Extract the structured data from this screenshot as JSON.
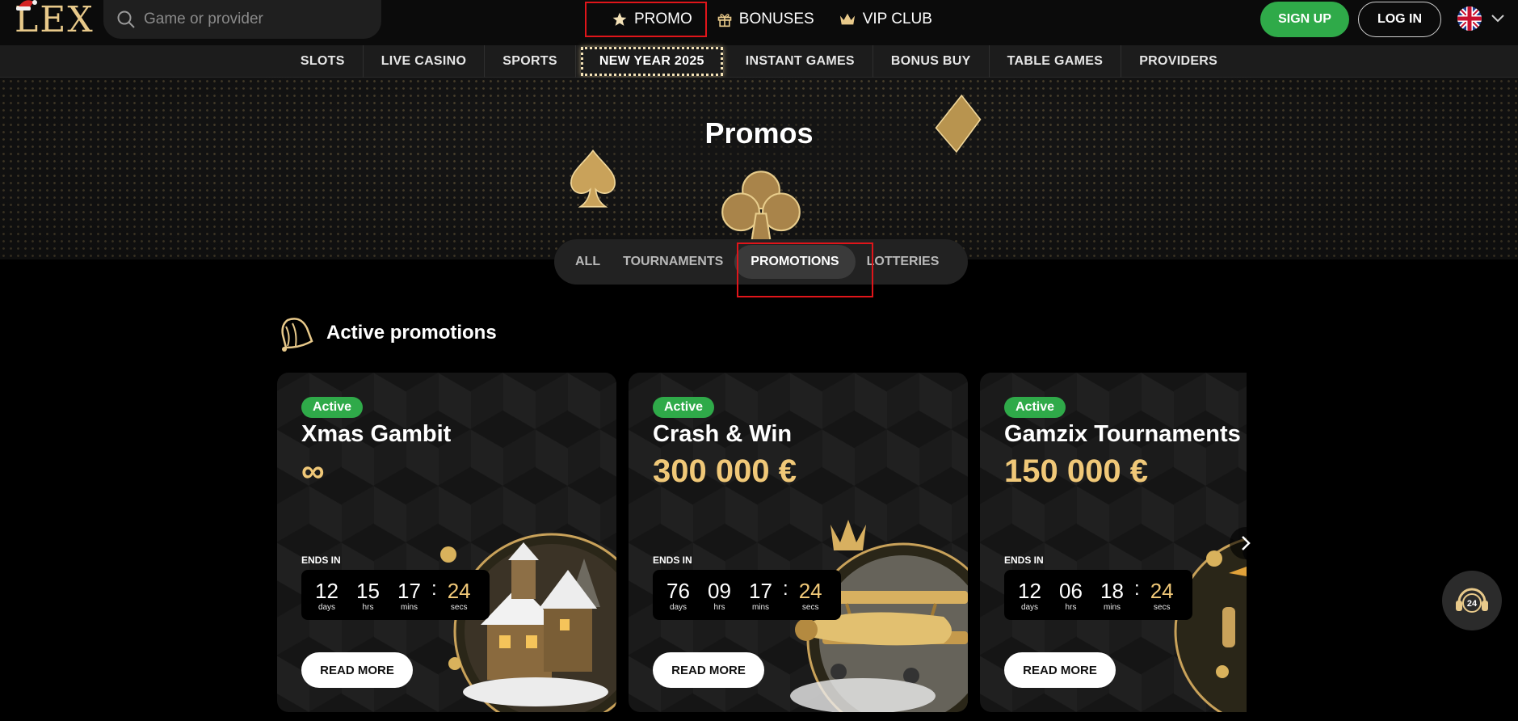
{
  "header": {
    "logo_text": "LEX",
    "search_placeholder": "Game or provider",
    "nav": [
      {
        "label": "PROMO",
        "icon": "star-icon"
      },
      {
        "label": "BONUSES",
        "icon": "gift-icon"
      },
      {
        "label": "VIP CLUB",
        "icon": "crown-icon"
      }
    ],
    "signup_label": "SIGN UP",
    "login_label": "LOG IN",
    "language_icon": "uk-flag-icon"
  },
  "categories": [
    "SLOTS",
    "LIVE CASINO",
    "SPORTS",
    "NEW YEAR 2025",
    "INSTANT GAMES",
    "BONUS BUY",
    "TABLE GAMES",
    "PROVIDERS"
  ],
  "hero": {
    "title": "Promos"
  },
  "tabs": [
    {
      "label": "ALL",
      "active": false
    },
    {
      "label": "TOURNAMENTS",
      "active": false
    },
    {
      "label": "PROMOTIONS",
      "active": true
    },
    {
      "label": "LOTTERIES",
      "active": false
    }
  ],
  "section": {
    "title": "Active promotions",
    "icon": "bell-icon"
  },
  "cards": [
    {
      "badge": "Active",
      "title": "Xmas Gambit",
      "amount": "∞",
      "ends_label": "ENDS IN",
      "timer": {
        "days": "12",
        "hrs": "15",
        "mins": "17",
        "secs": "24"
      },
      "button": "READ MORE",
      "art": "winter-village-art"
    },
    {
      "badge": "Active",
      "title": "Crash & Win",
      "amount": "300 000 €",
      "ends_label": "ENDS IN",
      "timer": {
        "days": "76",
        "hrs": "09",
        "mins": "17",
        "secs": "24"
      },
      "button": "READ MORE",
      "art": "golden-plane-art"
    },
    {
      "badge": "Active",
      "title": "Gamzix Tournaments",
      "amount": "150 000 €",
      "ends_label": "ENDS IN",
      "timer": {
        "days": "12",
        "hrs": "06",
        "mins": "18",
        "secs": "24"
      },
      "button": "READ MORE",
      "art": "penguin-art"
    }
  ],
  "timer_units": {
    "days": "days",
    "hrs": "hrs",
    "mins": "mins",
    "secs": "secs"
  },
  "support_label": "24",
  "colors": {
    "accent_green": "#2faa49",
    "gold": "#f0c878",
    "highlight_red": "#e0151a"
  }
}
